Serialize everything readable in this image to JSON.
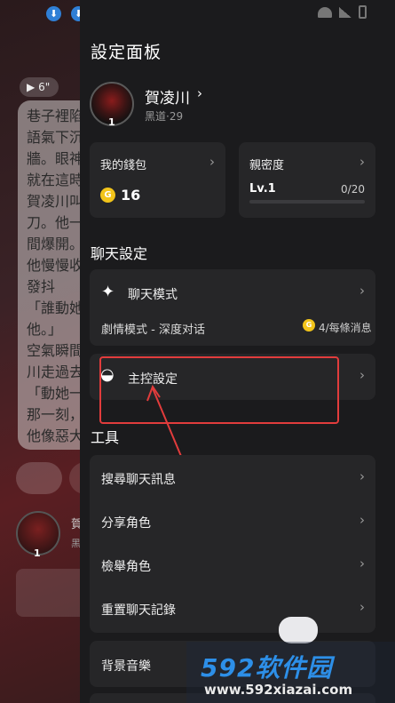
{
  "background": {
    "voice_duration": "6\"",
    "bubble_text": "巷子裡陷\n語氣下沉\n牆。眼神\n就在這時\n賀凌川叫\n刀。他一\n間爆開。\n他慢慢收\n發抖\n「誰動她\n他。」\n空氣瞬間\n川走過去\n「動她一\n那一刻，\n他像惡大",
    "mini_name": "賀",
    "mini_sub": "黑",
    "mini_level": "1"
  },
  "panel": {
    "title": "設定面板",
    "profile": {
      "name": "賀凌川",
      "chevron": "›",
      "subtitle": "黑道·29",
      "level": "1"
    },
    "wallet": {
      "label": "我的錢包",
      "coin_symbol": "G",
      "amount": "16"
    },
    "intimacy": {
      "label": "親密度",
      "level": "Lv.1",
      "progress": "0/20",
      "progress_fraction": 0
    },
    "chat_settings": {
      "heading": "聊天設定",
      "mode_label": "聊天模式",
      "mode_value": "劇情模式 - 深度对话",
      "cost_coin": "G",
      "cost_text": "4/每條消息",
      "control_label": "主控設定"
    },
    "tools": {
      "heading": "工具",
      "items": [
        {
          "label": "搜尋聊天訊息"
        },
        {
          "label": "分享角色"
        },
        {
          "label": "檢舉角色"
        },
        {
          "label": "重置聊天記錄"
        }
      ],
      "music_label": "背景音樂"
    }
  },
  "watermark": {
    "main": "592软件园",
    "url": "www.592xiazai.com"
  },
  "colors": {
    "accent_annotation": "#e23c3c",
    "coin": "#f2c41a",
    "panel_bg": "#1b1b1d",
    "card_bg": "#262628"
  }
}
